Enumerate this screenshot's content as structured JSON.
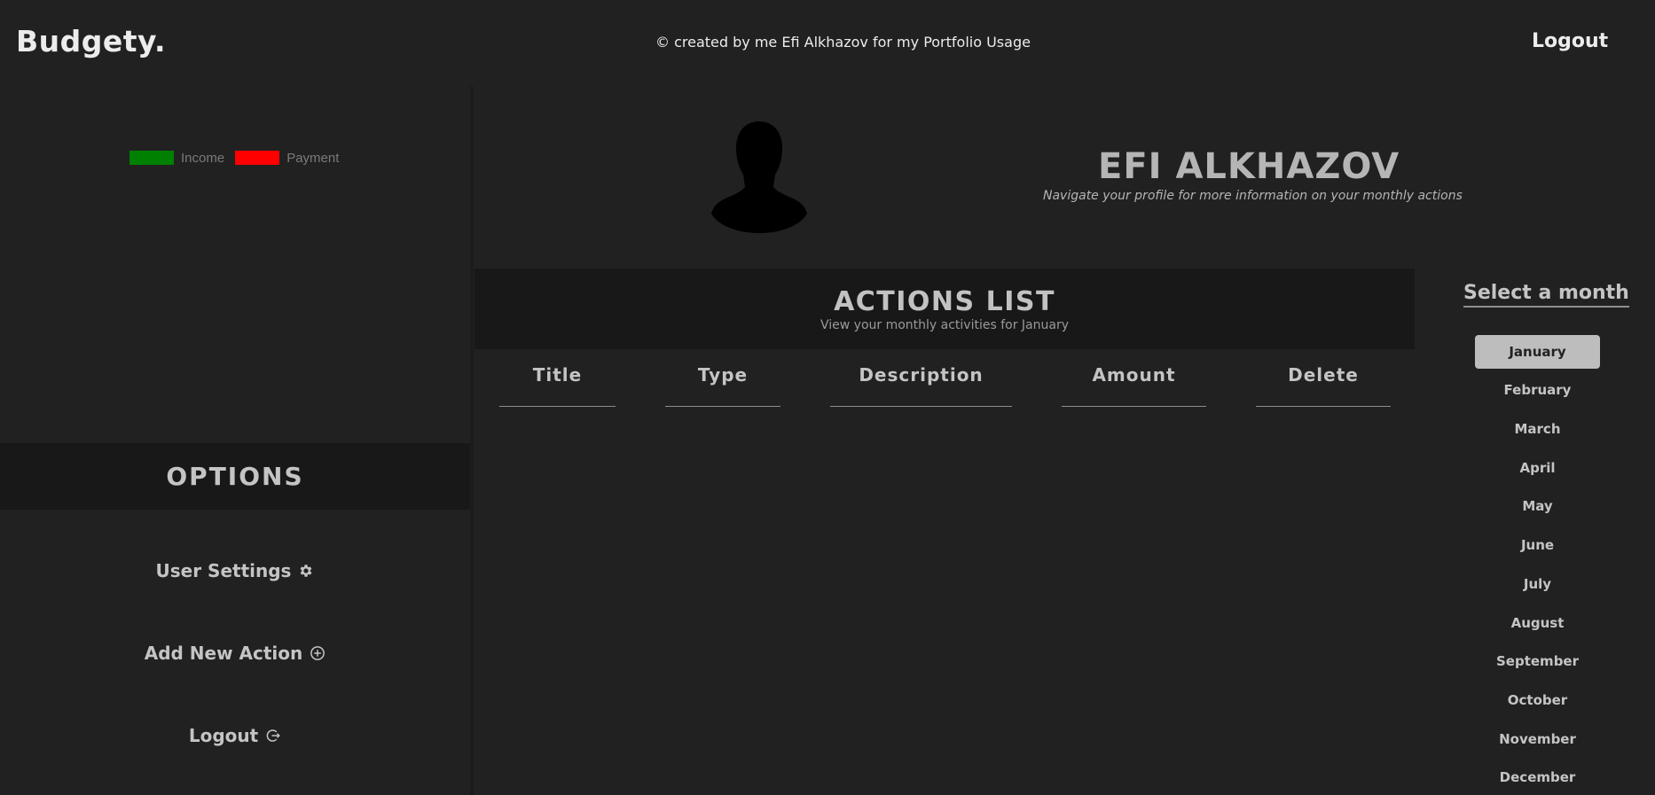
{
  "header": {
    "brand": "Budgety.",
    "credit": "© created by me Efi Alkhazov for my Portfolio Usage",
    "logout_label": "Logout"
  },
  "legend": {
    "income_label": "Income",
    "income_color": "#008000",
    "payment_label": "Payment",
    "payment_color": "#ff0000"
  },
  "options": {
    "title": "OPTIONS",
    "items": [
      {
        "label": "User Settings",
        "icon": "gear-icon"
      },
      {
        "label": "Add New Action",
        "icon": "plus-circle-icon"
      },
      {
        "label": "Logout",
        "icon": "logout-icon"
      }
    ]
  },
  "profile": {
    "name": "EFI ALKHAZOV",
    "subtitle": "Navigate your profile for more information on your monthly actions"
  },
  "actions": {
    "title": "ACTIONS LIST",
    "subtitle": "View your monthly activities for January",
    "columns": [
      "Title",
      "Type",
      "Description",
      "Amount",
      "Delete"
    ]
  },
  "months": {
    "title": "Select a month",
    "selected": "January",
    "items": [
      "January",
      "February",
      "March",
      "April",
      "May",
      "June",
      "July",
      "August",
      "September",
      "October",
      "November",
      "December"
    ]
  }
}
